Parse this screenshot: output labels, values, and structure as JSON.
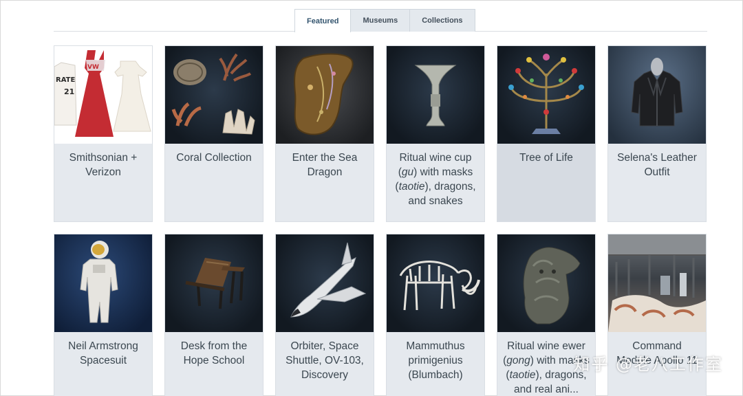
{
  "tabs": [
    {
      "label": "Featured",
      "active": true
    },
    {
      "label": "Museums",
      "active": false
    },
    {
      "label": "Collections",
      "active": false
    }
  ],
  "cards": [
    {
      "title": "Smithsonian + Verizon",
      "image_icon": "clothing-uniforms-image"
    },
    {
      "title": "Coral Collection",
      "image_icon": "coral-specimens-image"
    },
    {
      "title": "Enter the Sea Dragon",
      "image_icon": "sea-dragon-image"
    },
    {
      "title_parts": [
        "Ritual wine cup (",
        "gu",
        ") with masks (",
        "taotie",
        "), dragons, and snakes"
      ],
      "image_icon": "wine-cup-image"
    },
    {
      "title": "Tree of Life",
      "image_icon": "tree-of-life-image"
    },
    {
      "title": "Selena's Leather Outfit",
      "image_icon": "leather-jacket-image"
    },
    {
      "title": "Neil Armstrong Spacesuit",
      "image_icon": "spacesuit-image"
    },
    {
      "title": "Desk from the Hope School",
      "image_icon": "school-desk-image"
    },
    {
      "title": "Orbiter, Space Shuttle, OV-103, Discovery",
      "image_icon": "space-shuttle-image"
    },
    {
      "title": "Mammuthus primigenius (Blumbach)",
      "image_icon": "mammoth-skeleton-image"
    },
    {
      "title_parts": [
        "Ritual wine ewer (",
        "gong",
        ") with masks (",
        "taotie",
        "), dragons, and real ani..."
      ],
      "image_icon": "wine-ewer-image"
    },
    {
      "title": "Command Module Apollo 11",
      "image_icon": "command-module-image"
    }
  ],
  "watermark": "知乎 @老八工作室",
  "colors": {
    "tab_active_text": "#33546e",
    "card_bg": "#e5e9ee",
    "card_text": "#3b4750"
  }
}
